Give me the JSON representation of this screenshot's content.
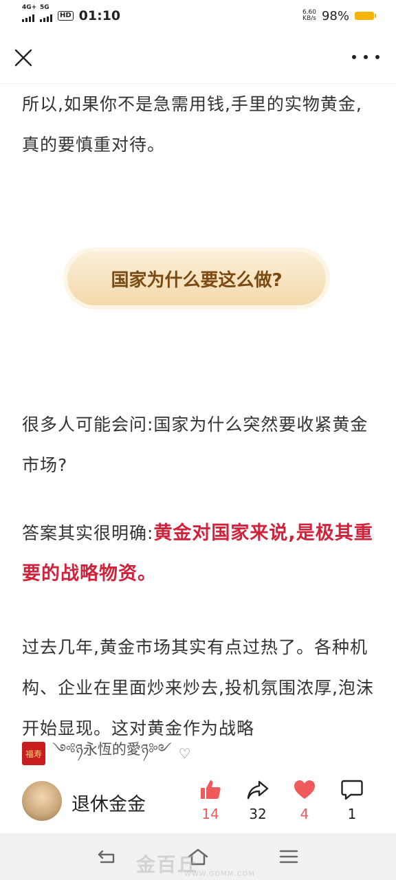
{
  "status": {
    "network_1": "4G+",
    "network_2": "5G",
    "hd": "HD",
    "time": "01:10",
    "net_speed_value": "6.60",
    "net_speed_unit": "KB/s",
    "battery": "98%"
  },
  "article": {
    "para1": "所以,如果你不是急需用钱,手里的实物黄金,真的要慎重对待。",
    "section_pill": "国家为什么要这么做?",
    "para2": "很多人可能会问:国家为什么突然要收紧黄金市场?",
    "para3_prefix": "答案其实很明确:",
    "para3_highlight": "黄金对国家来说,是极其重要的战略物资。",
    "para4": "过去几年,黄金市场其实有点过热了。各种机构、企业在里面炒来炒去,投机氛围浓厚,泡沫开始显现。这对黄金作为战略"
  },
  "author_line": {
    "thumb_text": "福寿",
    "signature": "༺ཉ永恆的愛ཉ༻",
    "heart_icon": "heart-outline-icon"
  },
  "profile": {
    "name": "退休金金"
  },
  "actions": {
    "like_count": "14",
    "share_count": "32",
    "favorite_count": "4",
    "comment_count": "1"
  },
  "colors": {
    "accent_red": "#d0223a",
    "like_red": "#f05a5a",
    "pill_text": "#7a4a12"
  },
  "watermark": {
    "text": "金百丘",
    "url": "WWW.GDMM.COM"
  }
}
